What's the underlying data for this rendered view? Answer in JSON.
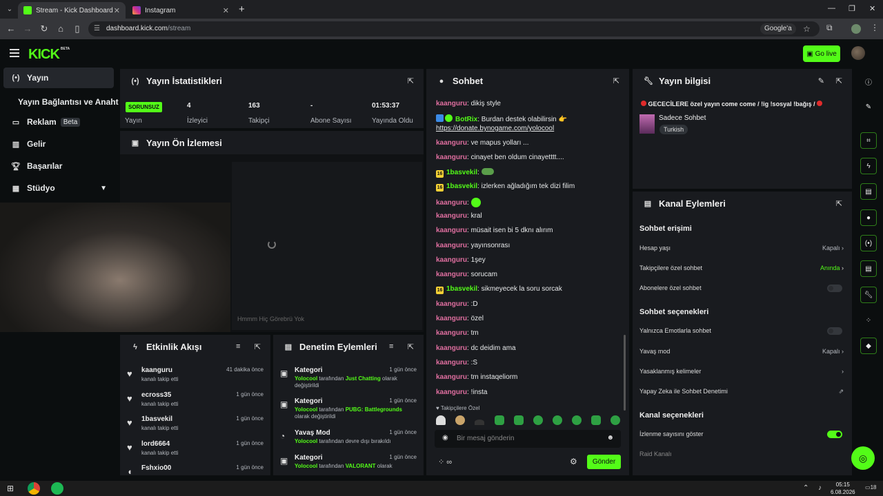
{
  "browser": {
    "tabs": [
      {
        "title": "Stream - Kick Dashboard",
        "active": true
      },
      {
        "title": "Instagram",
        "active": false
      }
    ],
    "url_host": "dashboard.kick.com",
    "url_path": "/stream",
    "google_btn": "Google'a"
  },
  "header": {
    "logo": "KICK",
    "logo_sup": "BETA",
    "go_live": "Go live"
  },
  "sidebar": {
    "items": [
      {
        "label": "Yayın",
        "icon": "broadcast-icon"
      },
      {
        "label": "Yayın Bağlantısı ve Anahtarı"
      },
      {
        "label": "Reklam",
        "badge": "Beta",
        "icon": "ads-icon"
      },
      {
        "label": "Gelir",
        "icon": "revenue-icon"
      },
      {
        "label": "Başarılar",
        "icon": "trophy-icon"
      },
      {
        "label": "Stüdyo",
        "icon": "studio-icon"
      }
    ]
  },
  "stats": {
    "title": "Yayın İstatistikleri",
    "status_badge": "SORUNSUZ",
    "status_label": "Yayın",
    "viewers": {
      "value": "4",
      "label": "İzleyici"
    },
    "followers": {
      "value": "163",
      "label": "Takipçi"
    },
    "subs": {
      "value": "-",
      "label": "Abone Sayısı"
    },
    "uptime": {
      "value": "01:53:37",
      "label": "Yayında Olduğu Süre"
    }
  },
  "preview": {
    "title": "Yayın Ön İzlemesi",
    "caption": "Hmmm Hiç Görebrü Yok"
  },
  "events": {
    "title": "Etkinlik Akışı",
    "items": [
      {
        "user": "kaanguru",
        "text": "kanalı takip etti",
        "time": "41 dakika önce"
      },
      {
        "user": "ecross35",
        "text": "kanalı takip etti",
        "time": "1 gün önce"
      },
      {
        "user": "1basvekil",
        "text": "kanalı takip etti",
        "time": "1 gün önce"
      },
      {
        "user": "lord6664",
        "text": "kanalı takip etti",
        "time": "1 gün önce"
      },
      {
        "user": "Fshxio00",
        "text": "",
        "time": "1 gün önce"
      }
    ]
  },
  "moderation": {
    "title": "Denetim Eylemleri",
    "items": [
      {
        "type": "Kategori",
        "time": "1 gün önce",
        "actor": "Yolocool",
        "mid": "tarafından",
        "target": "Just Chatting",
        "end": "olarak değiştirildi"
      },
      {
        "type": "Kategori",
        "time": "1 gün önce",
        "actor": "Yolocool",
        "mid": "tarafından",
        "target": "PUBG: Battlegrounds",
        "end": "olarak değiştirildi"
      },
      {
        "type": "Yavaş Mod",
        "time": "1 gün önce",
        "actor": "Yolocool",
        "mid": "tarafından devre dışı bırakıldı",
        "target": "",
        "end": ""
      },
      {
        "type": "Kategori",
        "time": "1 gün önce",
        "actor": "Yolocool",
        "mid": "tarafından",
        "target": "VALORANT",
        "end": "olarak"
      }
    ]
  },
  "chat": {
    "title": "Sohbet",
    "messages": [
      {
        "user": "kaanguru",
        "text": ": dikiş style"
      },
      {
        "user": "BotRix",
        "text": ": Burdan destek olabilirsin 👉"
      },
      {
        "user": "",
        "text": "https://donate.bynogame.com/yolocool"
      },
      {
        "user": "kaanguru",
        "text": ": ve mapus yolları ..."
      },
      {
        "user": "kaanguru",
        "text": ": cinayet ben oldum cinayetttt...."
      },
      {
        "user": "1basvekil",
        "text": ":"
      },
      {
        "user": "1basvekil",
        "text": ": izlerken ağladığım tek dizi filim"
      },
      {
        "user": "kaanguru",
        "text": ":"
      },
      {
        "user": "kaanguru",
        "text": ": kral"
      },
      {
        "user": "kaanguru",
        "text": ": müsait isen bi 5 dknı alırım"
      },
      {
        "user": "kaanguru",
        "text": ": yayınsonrası"
      },
      {
        "user": "kaanguru",
        "text": ": 1şey"
      },
      {
        "user": "kaanguru",
        "text": ": sorucam"
      },
      {
        "user": "1basvekil",
        "text": ": sikmeyecek la soru sorcak"
      },
      {
        "user": "kaanguru",
        "text": ": :D"
      },
      {
        "user": "kaanguru",
        "text": ": özel"
      },
      {
        "user": "kaanguru",
        "text": ": tm"
      },
      {
        "user": "kaanguru",
        "text": ": dc deidim ama"
      },
      {
        "user": "kaanguru",
        "text": ": :S"
      },
      {
        "user": "kaanguru",
        "text": ": tm instaqeliorm"
      },
      {
        "user": "kaanguru",
        "text": ": !insta"
      }
    ],
    "followers_only": "Takipçilere Özel",
    "placeholder": "Bir mesaj gönderin",
    "send": "Gönder",
    "badge16": "16"
  },
  "info": {
    "title": "Yayın bilgisi",
    "stream_title": "GECECİLERE özel yayın come come / !ig !sosyal !bağış /",
    "category": "Sadece Sohbet",
    "tag": "Turkish"
  },
  "channel_actions": {
    "title": "Kanal Eylemleri",
    "chat_access": "Sohbet erişimi",
    "account_age": {
      "label": "Hesap yaşı",
      "value": "Kapalı"
    },
    "followers_chat": {
      "label": "Takipçilere özel sohbet",
      "value": "Anında"
    },
    "subs_chat": {
      "label": "Abonelere özel sohbet"
    },
    "chat_options": "Sohbet seçenekleri",
    "emote_only": {
      "label": "Yalnızca Emotlarla sohbet"
    },
    "slow_mode": {
      "label": "Yavaş mod",
      "value": "Kapalı"
    },
    "banned_words": {
      "label": "Yasaklanmış kelimeler"
    },
    "ai_mod": {
      "label": "Yapay Zeka ile Sohbet Denetimi"
    },
    "channel_options": "Kanal seçenekleri",
    "show_viewers": {
      "label": "İzlenme sayısını göster",
      "on": true
    },
    "raid": {
      "label": "Raid Kanalı"
    }
  },
  "taskbar": {
    "time": "05:15",
    "date": "6.08.2026",
    "notif": "18"
  },
  "colors": {
    "accent": "#53fc18",
    "panel": "#191b1f",
    "bg": "#0b0e0f"
  }
}
